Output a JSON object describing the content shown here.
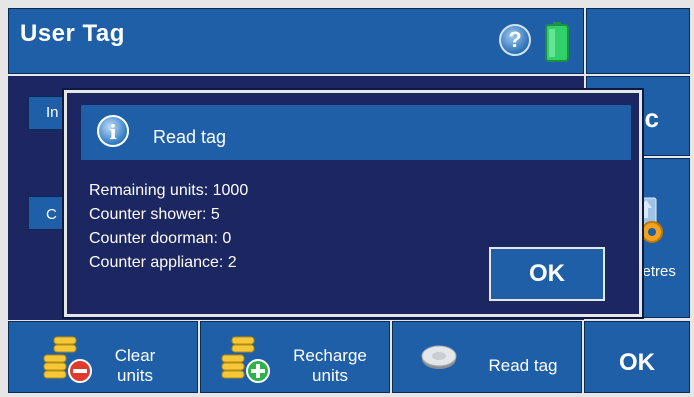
{
  "header": {
    "title": "User Tag"
  },
  "background_panel": {
    "button_1_label": "In",
    "button_2_label": "C"
  },
  "right_column": {
    "esc_label": "sc",
    "params_label": "metres"
  },
  "dialog": {
    "title": "Read tag",
    "lines": [
      "Remaining units: 1000",
      "Counter shower: 5",
      "Counter doorman: 0",
      "Counter appliance: 2"
    ],
    "ok_label": "OK"
  },
  "bottom_bar": {
    "clear_units_label_1": "Clear",
    "clear_units_label_2": "units",
    "recharge_units_label_1": "Recharge",
    "recharge_units_label_2": "units",
    "read_tag_label": "Read tag",
    "ok_label": "OK"
  },
  "colors": {
    "panel_blue": "#1e5fa8",
    "dialog_navy": "#1c2661",
    "battery_green": "#2fd06a"
  },
  "icons": [
    "help-icon",
    "battery-icon",
    "info-icon",
    "gear-icon",
    "coins-remove-icon",
    "coins-add-icon",
    "tag-icon"
  ]
}
